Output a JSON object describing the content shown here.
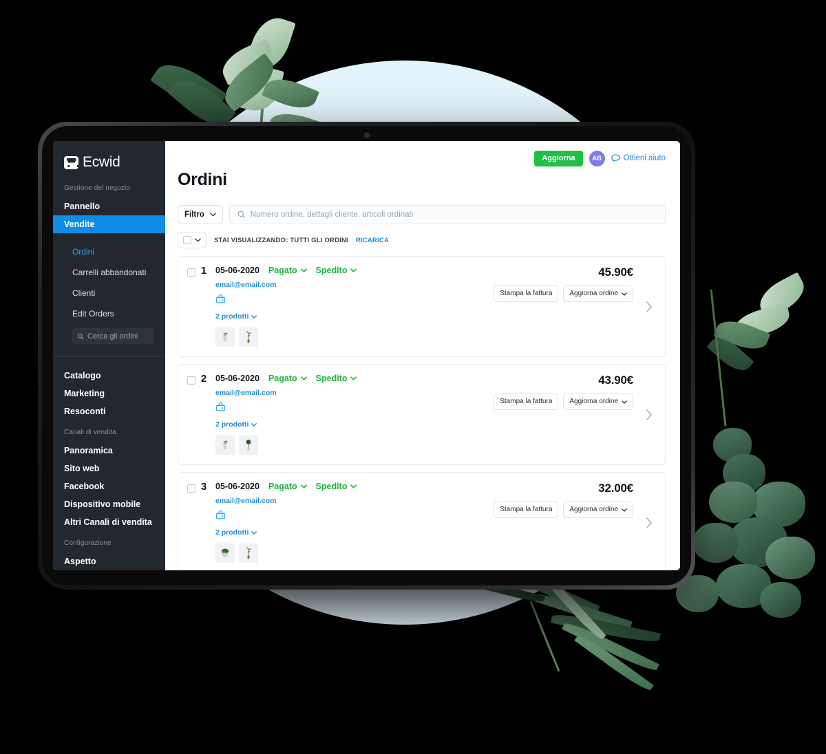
{
  "brand": {
    "name": "Ecwid",
    "logo_icon": "shopping-cart-icon"
  },
  "sidebar": {
    "section_store": "Gestione del negozio",
    "items": [
      {
        "label": "Pannello"
      },
      {
        "label": "Vendite"
      }
    ],
    "sub_items": [
      {
        "label": "Ordini"
      },
      {
        "label": "Carrelli abbandonati"
      },
      {
        "label": "Clienti"
      },
      {
        "label": "Edit Orders"
      }
    ],
    "search_placeholder": "Cerca gli ordini",
    "search_icon": "search-icon",
    "group_items": [
      {
        "label": "Catalogo"
      },
      {
        "label": "Marketing"
      },
      {
        "label": "Resoconti"
      }
    ],
    "section_channels": "Canali di vendita",
    "channel_items": [
      {
        "label": "Panoramica"
      },
      {
        "label": "Sito web"
      },
      {
        "label": "Facebook"
      },
      {
        "label": "Dispositivo mobile"
      },
      {
        "label": "Altri Canali di vendita"
      }
    ],
    "section_config": "Configurazione",
    "config_items": [
      {
        "label": "Aspetto"
      }
    ],
    "active_color": "#0d8ce8",
    "background": "#23272f"
  },
  "topbar": {
    "upgrade_label": "Aggiorna",
    "upgrade_color": "#21bf45",
    "avatar_initials": "AB",
    "avatar_color": "#7b7bea",
    "help_label": "Ottieni aiuto",
    "help_icon": "chat-bubble-icon",
    "help_color": "#1f8cdb"
  },
  "page": {
    "title": "Ordini"
  },
  "toolbar": {
    "filter_label": "Filtro",
    "filter_chevron_icon": "chevron-down-icon",
    "search_placeholder": "Numero ordine, dettagli cliente, articoli ordinati",
    "search_icon": "search-icon"
  },
  "subbar": {
    "select_all_icon": "checkbox-icon",
    "select_all_chevron_icon": "chevron-down-icon",
    "viewing_label": "STAI VISUALIZZANDO: TUTTI GLI ORDINI",
    "reload_label": "RICARICA"
  },
  "orders": {
    "payment_icon": "shopping-bag-icon",
    "products_chevron_icon": "chevron-down-icon",
    "status_chevron_icon": "chevron-down-icon",
    "expand_icon": "chevron-right-icon",
    "print_label": "Stampa la fattura",
    "update_label": "Aggiorna ordine",
    "update_chevron_icon": "chevron-down-icon",
    "status_color": "#1cb33c",
    "link_color": "#1f8cdb",
    "rows": [
      {
        "number": "1",
        "date": "05-06-2020",
        "payment_status": "Pagato",
        "shipping_status": "Spedito",
        "email": "email@email.com",
        "products_label": "2 prodotti",
        "total": "45.90€",
        "thumbs": [
          {
            "kind": "potted-sprout"
          },
          {
            "kind": "tall-plant"
          }
        ]
      },
      {
        "number": "2",
        "date": "05-06-2020",
        "payment_status": "Pagato",
        "shipping_status": "Spedito",
        "email": "email@email.com",
        "products_label": "2 prodotti",
        "total": "43.90€",
        "thumbs": [
          {
            "kind": "potted-sprout"
          },
          {
            "kind": "topiary"
          }
        ]
      },
      {
        "number": "3",
        "date": "05-06-2020",
        "payment_status": "Pagato",
        "shipping_status": "Spedito",
        "email": "email@email.com",
        "products_label": "2 prodotti",
        "total": "32.00€",
        "thumbs": [
          {
            "kind": "bowl-plant"
          },
          {
            "kind": "tall-plant"
          }
        ]
      }
    ]
  },
  "decor": {
    "circle_color": "#e2f3fb",
    "background_color": "#000000"
  }
}
